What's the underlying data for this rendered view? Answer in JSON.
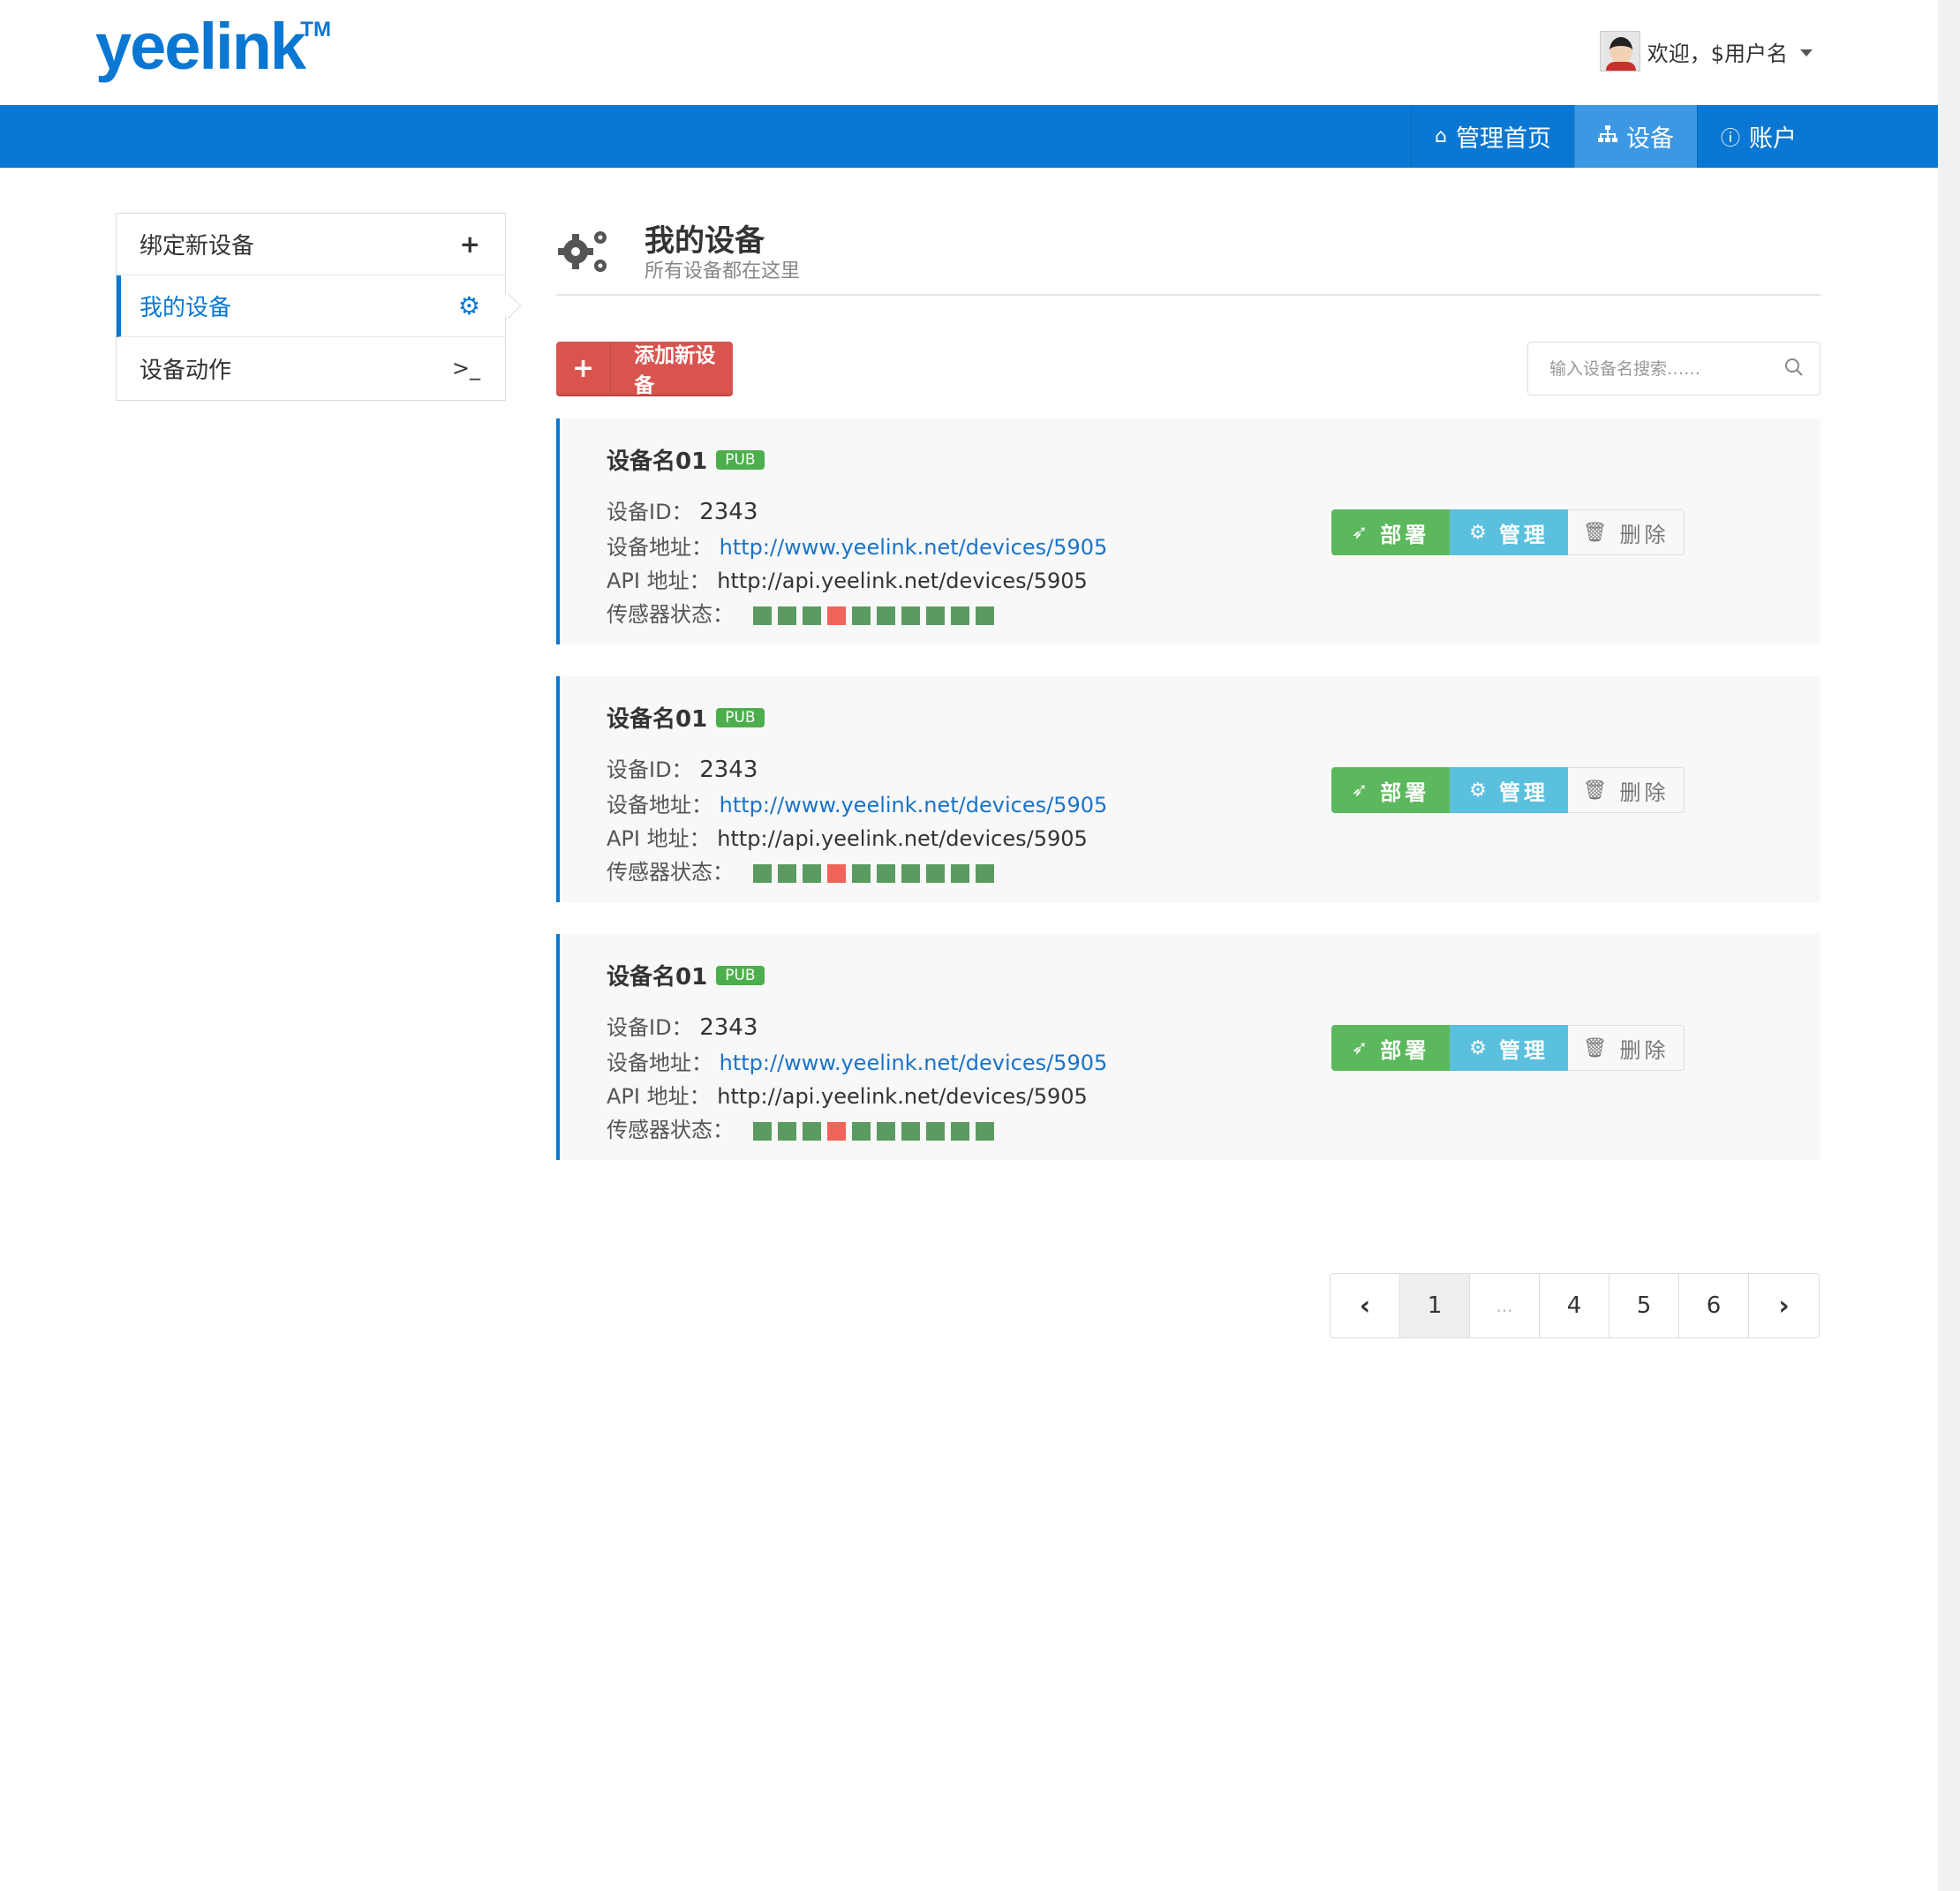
{
  "brand": {
    "logo": "yeelink",
    "tm": "TM"
  },
  "user": {
    "greeting": "欢迎，$用户名"
  },
  "nav": {
    "home": "管理首页",
    "devices": "设备",
    "account": "账户"
  },
  "sidebar": {
    "items": [
      {
        "label": "绑定新设备",
        "icon": "+"
      },
      {
        "label": "我的设备",
        "icon": "⚙"
      },
      {
        "label": "设备动作",
        "icon": ">_"
      }
    ]
  },
  "page": {
    "title": "我的设备",
    "subtitle": "所有设备都在这里"
  },
  "toolbar": {
    "add_label": "添加新设备",
    "search_placeholder": "输入设备名搜索……"
  },
  "labels": {
    "device_id": "设备ID：",
    "device_url": "设备地址：",
    "api_url": "API 地址：",
    "sensor_status": "传感器状态：",
    "deploy": "部署",
    "manage": "管理",
    "delete": "删除"
  },
  "devices": [
    {
      "name": "设备名01",
      "badge": "PUB",
      "id": "2343",
      "url": "http://www.yeelink.net/devices/5905",
      "api": "http://api.yeelink.net/devices/5905",
      "sensors": [
        "ok",
        "ok",
        "ok",
        "bad",
        "ok",
        "ok",
        "ok",
        "ok",
        "ok",
        "ok"
      ]
    },
    {
      "name": "设备名01",
      "badge": "PUB",
      "id": "2343",
      "url": "http://www.yeelink.net/devices/5905",
      "api": "http://api.yeelink.net/devices/5905",
      "sensors": [
        "ok",
        "ok",
        "ok",
        "bad",
        "ok",
        "ok",
        "ok",
        "ok",
        "ok",
        "ok"
      ]
    },
    {
      "name": "设备名01",
      "badge": "PUB",
      "id": "2343",
      "url": "http://www.yeelink.net/devices/5905",
      "api": "http://api.yeelink.net/devices/5905",
      "sensors": [
        "ok",
        "ok",
        "ok",
        "bad",
        "ok",
        "ok",
        "ok",
        "ok",
        "ok",
        "ok"
      ]
    }
  ],
  "pagination": {
    "prev": "‹",
    "pages": [
      "1",
      "...",
      "4",
      "5",
      "6"
    ],
    "next": "›",
    "current": "1"
  },
  "colors": {
    "brand_blue": "#0a78d2",
    "danger": "#d9534f",
    "success": "#5cb85c",
    "info": "#5bc0de",
    "sensor_ok": "#5b9b61",
    "sensor_bad": "#f06459"
  }
}
